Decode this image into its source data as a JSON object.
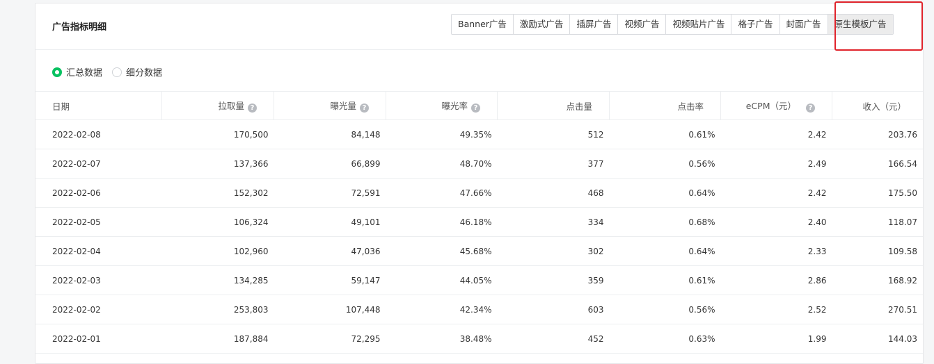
{
  "panel": {
    "title": "广告指标明细",
    "tabs": [
      {
        "label": "Banner广告"
      },
      {
        "label": "激励式广告"
      },
      {
        "label": "插屏广告"
      },
      {
        "label": "视频广告"
      },
      {
        "label": "视频贴片广告"
      },
      {
        "label": "格子广告"
      },
      {
        "label": "封面广告"
      },
      {
        "label": "原生模板广告",
        "active": true
      }
    ],
    "highlight_color": "#e0232b"
  },
  "view_options": {
    "summary_label": "汇总数据",
    "detail_label": "细分数据",
    "selected": "汇总数据",
    "accent": "#07c160"
  },
  "table": {
    "columns": [
      {
        "label": "日期",
        "help": false
      },
      {
        "label": "拉取量",
        "help": true
      },
      {
        "label": "曝光量",
        "help": true
      },
      {
        "label": "曝光率",
        "help": true
      },
      {
        "label": "点击量",
        "help": false
      },
      {
        "label": "点击率",
        "help": false
      },
      {
        "label": "eCPM（元）",
        "help": true
      },
      {
        "label": "收入（元）",
        "help": false
      }
    ],
    "help_icon": "question-circle-icon",
    "rows": [
      [
        "2022-02-08",
        "170,500",
        "84,148",
        "49.35%",
        "512",
        "0.61%",
        "2.42",
        "203.76"
      ],
      [
        "2022-02-07",
        "137,366",
        "66,899",
        "48.70%",
        "377",
        "0.56%",
        "2.49",
        "166.54"
      ],
      [
        "2022-02-06",
        "152,302",
        "72,591",
        "47.66%",
        "468",
        "0.64%",
        "2.42",
        "175.50"
      ],
      [
        "2022-02-05",
        "106,324",
        "49,101",
        "46.18%",
        "334",
        "0.68%",
        "2.40",
        "118.07"
      ],
      [
        "2022-02-04",
        "102,960",
        "47,036",
        "45.68%",
        "302",
        "0.64%",
        "2.33",
        "109.58"
      ],
      [
        "2022-02-03",
        "134,285",
        "59,147",
        "44.05%",
        "359",
        "0.61%",
        "2.86",
        "168.92"
      ],
      [
        "2022-02-02",
        "253,803",
        "107,448",
        "42.34%",
        "603",
        "0.56%",
        "2.52",
        "270.51"
      ],
      [
        "2022-02-01",
        "187,884",
        "72,295",
        "38.48%",
        "452",
        "0.63%",
        "1.99",
        "144.03"
      ]
    ]
  }
}
